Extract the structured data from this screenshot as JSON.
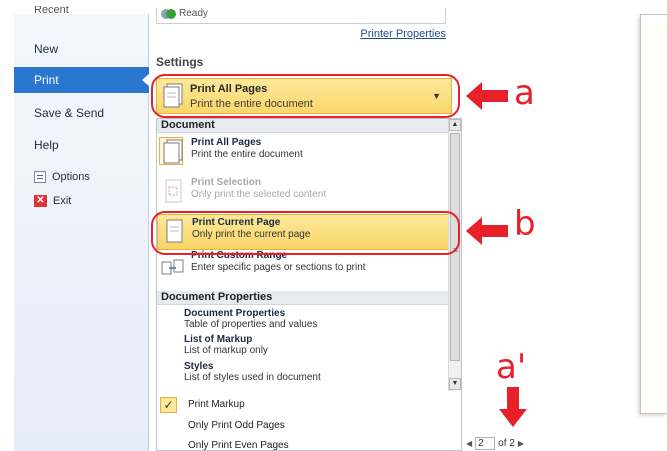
{
  "nav": {
    "cut_item": "Recent",
    "items": [
      {
        "label": "New"
      },
      {
        "label": "Print"
      },
      {
        "label": "Save & Send"
      },
      {
        "label": "Help"
      }
    ],
    "small_items": [
      {
        "label": "Options",
        "icon": "options-icon"
      },
      {
        "label": "Exit",
        "icon": "exit-icon"
      }
    ]
  },
  "printer": {
    "status": "Ready",
    "properties_link": "Printer Properties"
  },
  "settings": {
    "title": "Settings",
    "selected_title": "Print All Pages",
    "selected_subtitle": "Print the entire document"
  },
  "dropdown": {
    "section_document": "Document",
    "options": [
      {
        "title": "Print All Pages",
        "subtitle": "Print the entire document"
      },
      {
        "title": "Print Selection",
        "subtitle": "Only print the selected content"
      },
      {
        "title": "Print Current Page",
        "subtitle": "Only print the current page"
      },
      {
        "title": "Print Custom Range",
        "subtitle": "Enter specific pages or sections to print"
      }
    ],
    "section_properties": "Document Properties",
    "properties": [
      {
        "title": "Document Properties",
        "subtitle": "Table of properties and values"
      },
      {
        "title": "List of Markup",
        "subtitle": "List of markup only"
      },
      {
        "title": "Styles",
        "subtitle": "List of styles used in document"
      }
    ],
    "toggles": [
      {
        "label": "Print Markup",
        "checked": "✓"
      },
      {
        "label": "Only Print Odd Pages"
      },
      {
        "label": "Only Print Even Pages"
      }
    ]
  },
  "pager": {
    "current": "2",
    "of_total": "of 2"
  },
  "annotations": {
    "a": "a",
    "b": "b",
    "a_prime": "a'"
  },
  "colors": {
    "annotation_red": "#e8202a",
    "selection_yellow": "#f9d66a",
    "nav_active_blue": "#2a77cf"
  }
}
